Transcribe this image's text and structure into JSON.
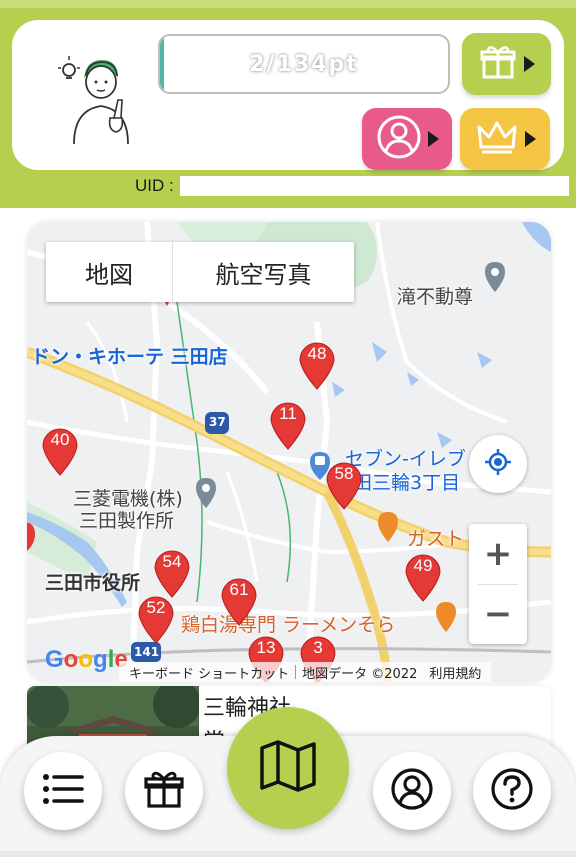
{
  "header": {
    "points": "2/134pt",
    "uid_label": "UID :",
    "uid_value": ""
  },
  "icons": {
    "gift": "gift-icon",
    "profile": "user-icon",
    "crown": "crown-icon",
    "list": "list-icon",
    "map": "map-icon",
    "help": "question-icon",
    "locate": "crosshair-icon"
  },
  "colors": {
    "brand_green": "#b5cf4f",
    "pink": "#e85a8c",
    "yellow": "#f4c542",
    "marker_red": "#e53935"
  },
  "map": {
    "tabs": [
      "地図",
      "航空写真"
    ],
    "labels": {
      "shrine_fudo": "滝不動尊",
      "donki": "ドン・キホーテ 三田店",
      "seven": "セブン-イレブ",
      "seven2": "田三輪3丁目",
      "mitsubishi1": "三菱電機(株)",
      "mitsubishi2": "三田製作所",
      "city_hall": "三田市役所",
      "gusto": "ガスト",
      "ramen": "鶏白湯専門 ラーメンそら",
      "route": "37",
      "route2": "141"
    },
    "markers": [
      "48",
      "11",
      "40",
      "58",
      "54",
      "61",
      "52",
      "49",
      "3",
      "13"
    ],
    "zoom_in": "+",
    "zoom_out": "−",
    "google": "Google",
    "attribution": {
      "shortcuts": "キーボード ショートカット",
      "map_data": "地図データ ©2022",
      "terms": "利用規約"
    }
  },
  "info": {
    "title": "三輪神社",
    "subtitle": "常"
  }
}
